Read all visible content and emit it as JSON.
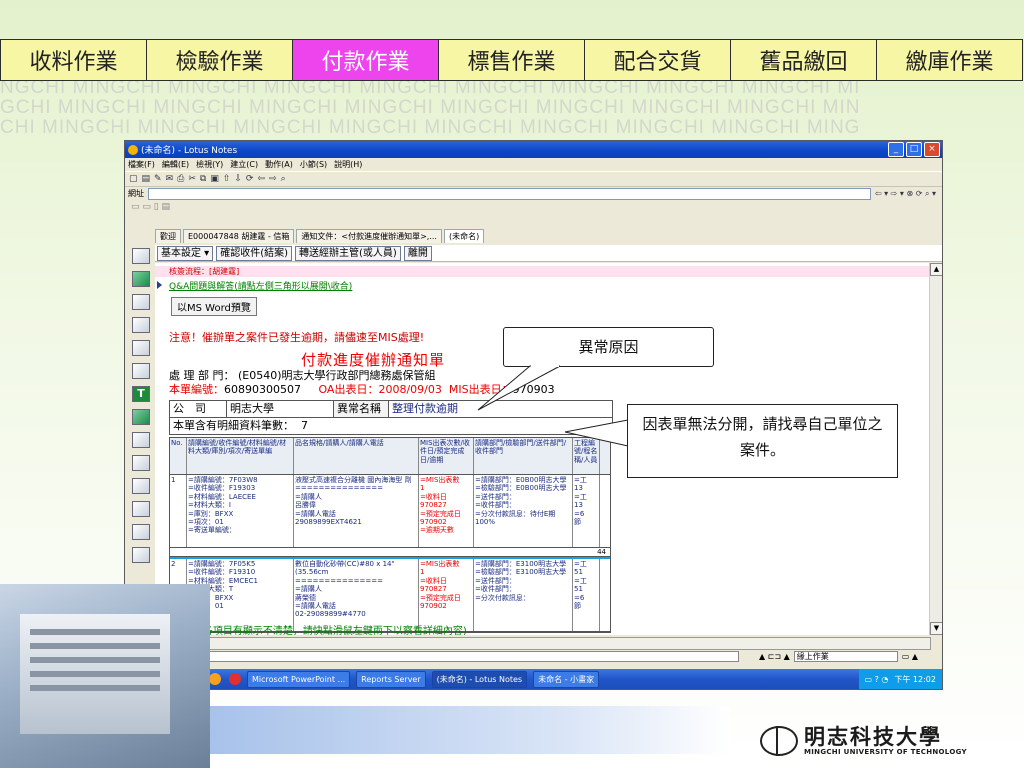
{
  "nav": {
    "tabs": [
      "收料作業",
      "檢驗作業",
      "付款作業",
      "標售作業",
      "配合交貨",
      "舊品繳回",
      "繳庫作業"
    ],
    "active_index": 2
  },
  "background": {
    "lines": [
      "NGCHI MINGCHI MINGCHI MINGCHI MINGCHI MINGCHI MINGCHI MINGCHI MINGCHI MI",
      "GCHI MINGCHI MINGCHI MINGCHI MINGCHI MINGCHI MINGCHI MINGCHI MINGCHI MIN",
      "CHI MINGCHI MINGCHI MINGCHI MINGCHI MINGCHI MINGCHI MINGCHI MINGCHI MING"
    ]
  },
  "window": {
    "title": "(未命名) - Lotus Notes",
    "menu": [
      "檔案(F)",
      "編輯(E)",
      "檢視(Y)",
      "建立(C)",
      "動作(A)",
      "小節(S)",
      "說明(H)"
    ],
    "address_label": "網址",
    "tabs": [
      "歡迎",
      "E000047848 胡建霆 - 信箱",
      "通知文件：<付款進度催辦通知單>,...",
      "(未命名)"
    ],
    "actions": [
      "基本設定 ▾",
      "確認收件(結案)",
      "轉送經辦主管(或人員)",
      "離開"
    ]
  },
  "doc": {
    "reviewer": "核簽流程：[胡建霆]",
    "qa_link": "Q&A問題與解答(請點左側三角形以展開\\收合)",
    "word_button": "以MS Word預覽",
    "notice": "注意！催辦單之案件已發生逾期，請儘速至MIS處理!",
    "title": "付款進度催辦通知單",
    "dept_label": "處 理 部 門：",
    "dept_value": "(E0540)明志大學行政部門總務處保管組",
    "no_label": "本單編號：",
    "no_value": "60890300507",
    "oa_label": "OA出表日：",
    "oa_value": "2008/09/03",
    "mis_label": "MIS出表日：",
    "mis_value": "970903",
    "company_label": "公　司",
    "company_value": "明志大學",
    "exception_label": "異常名稱",
    "exception_value": "整理付款逾期",
    "count_label": "本單含有明細資料筆數：",
    "count_value": "7",
    "bottom_note": "(若上列各項目有顯示不清楚，請快點滑鼠左鍵兩下以察看詳細內容)"
  },
  "detail": {
    "headers": [
      "No.",
      "請購編號/收件編號/材料編號/材料大類/庫別/項次/寄送單編",
      "品名規格/請購人/請購人電話",
      "MIS出表次數/收件日/預定完成日/逾期",
      "請購部門/檢驗部門/送件部門/收件部門",
      "工程編號/程名稱/人員"
    ],
    "rows": [
      {
        "no": "1",
        "ids": "=請購編號：7F03W8\n=收件編號：F19303\n=材料編號：LAECEE\n=材料大類：I\n=庫別：BFXX\n=項次：01\n=寄送單編號：",
        "item": "液壓式高速複合分離機 國內海海型 劑\n===============\n=請購人\n呂勝偉\n=請購人電話\n29089899EXT4621",
        "dates": "=MIS出表數\n1\n=收料日\n970827\n=預定完成日\n970902\n=逾期天數",
        "depts": "=請購部門：E0B00明志大學\n=檢驗部門：E0B00明志大學\n=送件部門：\n=收件部門：\n=分次付款訊息：待付E期\n100%",
        "eng": "=工\n13\n=工\n13\n=6\n節"
      },
      {
        "no": "2",
        "ids": "=請購編號：7F05K5\n=收件編號：F19310\n=材料編號：EMCEC1\n=材料大類：T\n=庫別：BFXX\n=項次：01",
        "item": "數位自動化砂帶(CC)#80 x 14\"(35.56cm\n===============\n=請購人\n蔣榮德\n=請購人電話\n02-29089899#4770",
        "dates": "=MIS出表數\n1\n=收料日\n970827\n=預定完成日\n970902",
        "depts": "=請購部門：E3100明志大學\n=檢驗部門：E3100明志大學\n=送件部門：\n=收件部門：\n=分次付款訊息：",
        "eng": "=工\n51\n=工\n51\n=6\n節"
      }
    ],
    "extra_value": "44"
  },
  "status": {
    "view": "緣上作業"
  },
  "taskbar": {
    "start": "開始",
    "tasks": [
      "Microsoft PowerPoint ...",
      "Reports Server",
      "(未命名) - Lotus Notes",
      "未命名 - 小畫家"
    ],
    "clock": "下午 12:02"
  },
  "callouts": {
    "reason": "異常原因",
    "hint": "因表單無法分開，請找尋自己單位之案件。"
  },
  "logo": {
    "cn": "明志科技大學",
    "en": "MINGCHI UNIVERSITY OF TECHNOLOGY"
  }
}
